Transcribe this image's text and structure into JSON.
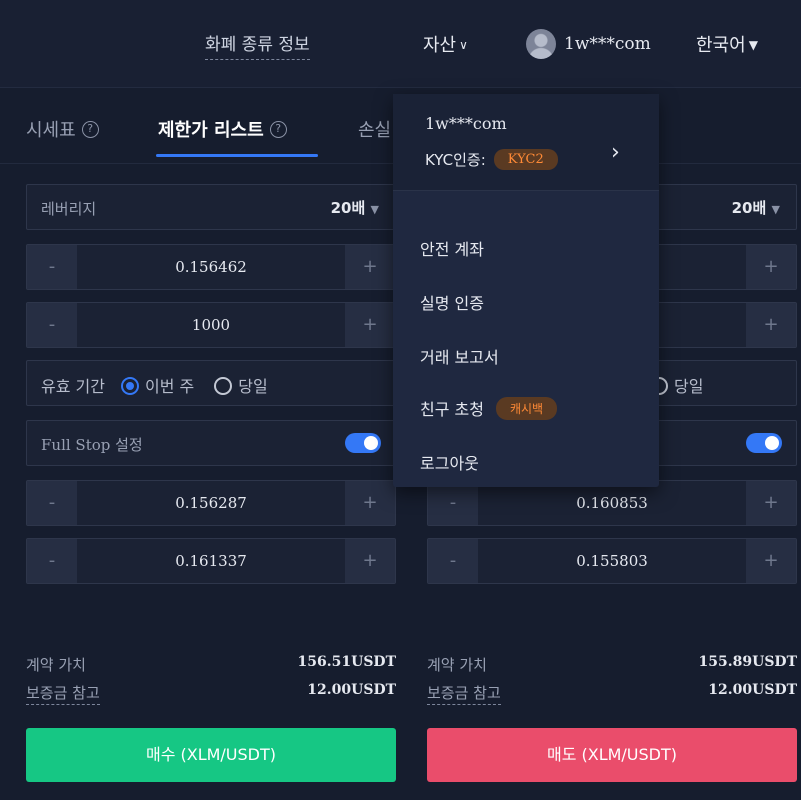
{
  "topbar": {
    "currency_info": "화폐 종류 정보",
    "assets": "자산",
    "user_email": "1w***com",
    "language": "한국어"
  },
  "tabs": [
    {
      "label": "시세표"
    },
    {
      "label": "제한가 리스트"
    },
    {
      "label": "손실"
    }
  ],
  "left": {
    "leverage_label": "레버리지",
    "leverage_value": "20배",
    "price": "0.156462",
    "amount": "1000",
    "validity_label": "유효 기간",
    "validity_opt1": "이번 주",
    "validity_opt2": "당일",
    "fullstop_label": "Full Stop 설정",
    "stop1": "0.156287",
    "stop2": "0.161337",
    "contract_value_label": "계약 가치",
    "contract_value": "156.51USDT",
    "margin_label": "보증금 참고",
    "margin_value": "12.00USDT",
    "buy_label": "매수 (XLM/USDT)"
  },
  "right": {
    "leverage_value": "20배",
    "validity_opt2": "당일",
    "stop1": "0.160853",
    "stop2": "0.155803",
    "contract_value_label": "계약 가치",
    "contract_value": "155.89USDT",
    "margin_label": "보증금 참고",
    "margin_value": "12.00USDT",
    "sell_label": "매도 (XLM/USDT)"
  },
  "stepper": {
    "minus": "-",
    "plus": "+"
  },
  "dropdown": {
    "email": "1w***com",
    "kyc_label": "KYC인증:",
    "kyc_badge": "KYC2",
    "items": [
      {
        "label": "안전 계좌"
      },
      {
        "label": "실명 인증"
      },
      {
        "label": "거래 보고서"
      },
      {
        "label": "친구 초청",
        "badge": "캐시백"
      },
      {
        "label": "로그아웃"
      }
    ]
  },
  "colors": {
    "accent": "#3478f6",
    "buy": "#16c784",
    "sell": "#ea4d6b",
    "badge_text": "#ff8a36"
  },
  "icons": [
    "help-icon",
    "caret-down-icon",
    "chevron-right-icon",
    "avatar-icon"
  ]
}
